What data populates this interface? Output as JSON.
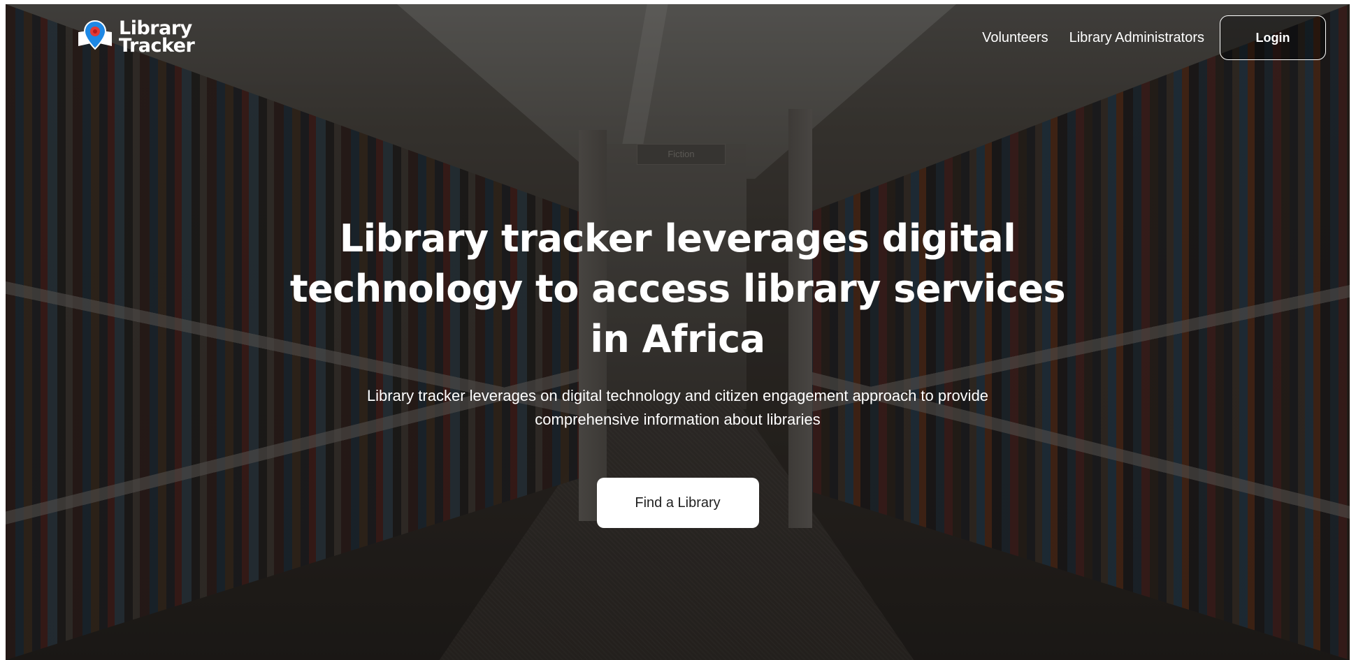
{
  "brand": {
    "name_line1": "Library",
    "name_line2": "Tracker",
    "logo_icon": "map-pin-book-icon",
    "accent_color": "#e53935",
    "pin_color": "#1e88e5"
  },
  "nav": {
    "links": [
      "Volunteers",
      "Library Administrators"
    ],
    "login_label": "Login"
  },
  "background": {
    "sign_text": "Fiction"
  },
  "hero": {
    "title": "Library tracker leverages digital technology to access library services in Africa",
    "subtitle": "Library tracker leverages on digital technology and citizen engagement approach to provide comprehensive information about libraries",
    "cta_label": "Find a Library"
  }
}
